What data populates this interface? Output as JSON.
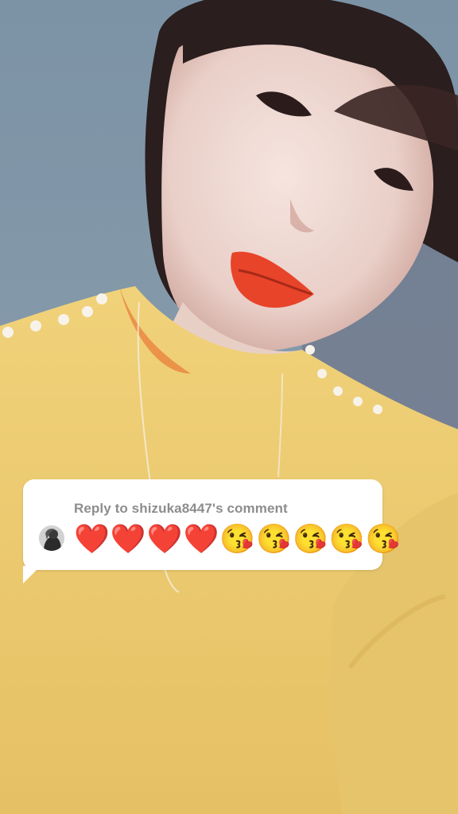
{
  "reply": {
    "header": "Reply to shizuka8447's comment",
    "comment_text": "❤️❤️❤️❤️😘😘😘😘😘"
  },
  "avatar": {
    "icon": "user-avatar"
  },
  "colors": {
    "card_background": "#ffffff",
    "header_text": "#8d8d8d",
    "sweater": "#e8c96a",
    "lips": "#e8442a"
  }
}
